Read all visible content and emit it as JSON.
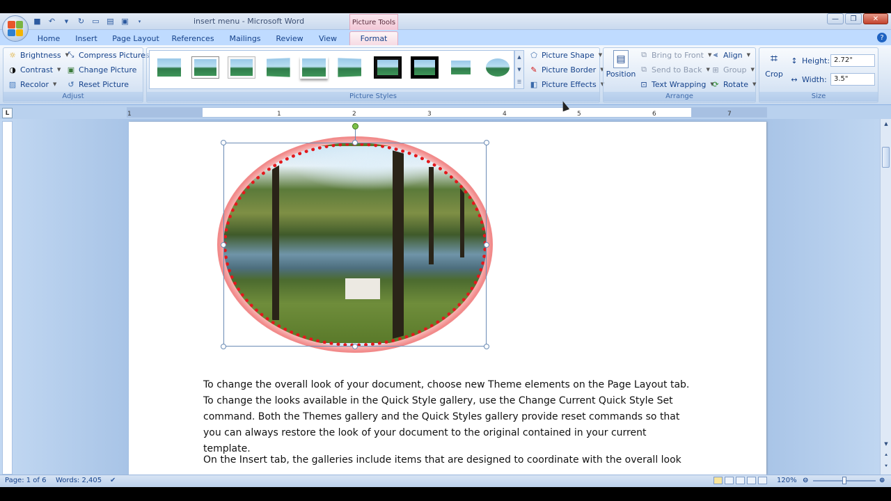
{
  "window": {
    "title": "insert menu - Microsoft Word",
    "contextual_tab_group": "Picture Tools"
  },
  "tabs": [
    {
      "label": "Home"
    },
    {
      "label": "Insert"
    },
    {
      "label": "Page Layout"
    },
    {
      "label": "References"
    },
    {
      "label": "Mailings"
    },
    {
      "label": "Review"
    },
    {
      "label": "View"
    },
    {
      "label": "Format"
    }
  ],
  "ribbon": {
    "adjust": {
      "label": "Adjust",
      "brightness": "Brightness",
      "contrast": "Contrast",
      "recolor": "Recolor",
      "compress": "Compress Pictures",
      "change": "Change Picture",
      "reset": "Reset Picture"
    },
    "picture_styles": {
      "label": "Picture Styles",
      "picture_shape": "Picture Shape",
      "picture_border": "Picture Border",
      "picture_effects": "Picture Effects"
    },
    "arrange": {
      "label": "Arrange",
      "position": "Position",
      "bring_to_front": "Bring to Front",
      "send_to_back": "Send to Back",
      "text_wrapping": "Text Wrapping",
      "align": "Align",
      "group": "Group",
      "rotate": "Rotate"
    },
    "size": {
      "label": "Size",
      "crop": "Crop",
      "height_label": "Height:",
      "height_value": "2.72\"",
      "width_label": "Width:",
      "width_value": "3.5\""
    }
  },
  "ruler": {
    "numbers": [
      "1",
      "1",
      "2",
      "3",
      "4",
      "5",
      "6",
      "7"
    ]
  },
  "document": {
    "para1": "To change the overall look of your document, choose new Theme elements on the Page Layout tab. To change the looks available in the Quick Style gallery, use the Change Current Quick Style Set command. Both the Themes gallery and the Quick Styles gallery provide reset commands so that you can always restore the look of your document to the original contained in your current template.",
    "para2": "On the Insert tab, the galleries include items that are designed to coordinate with the overall look of"
  },
  "statusbar": {
    "page": "Page: 1 of 6",
    "words": "Words: 2,405",
    "zoom": "120%"
  },
  "colors": {
    "picture_border": "#e3181c",
    "ribbon_bg": "#dae6f5",
    "contextual_tab": "#f3c7d6"
  }
}
